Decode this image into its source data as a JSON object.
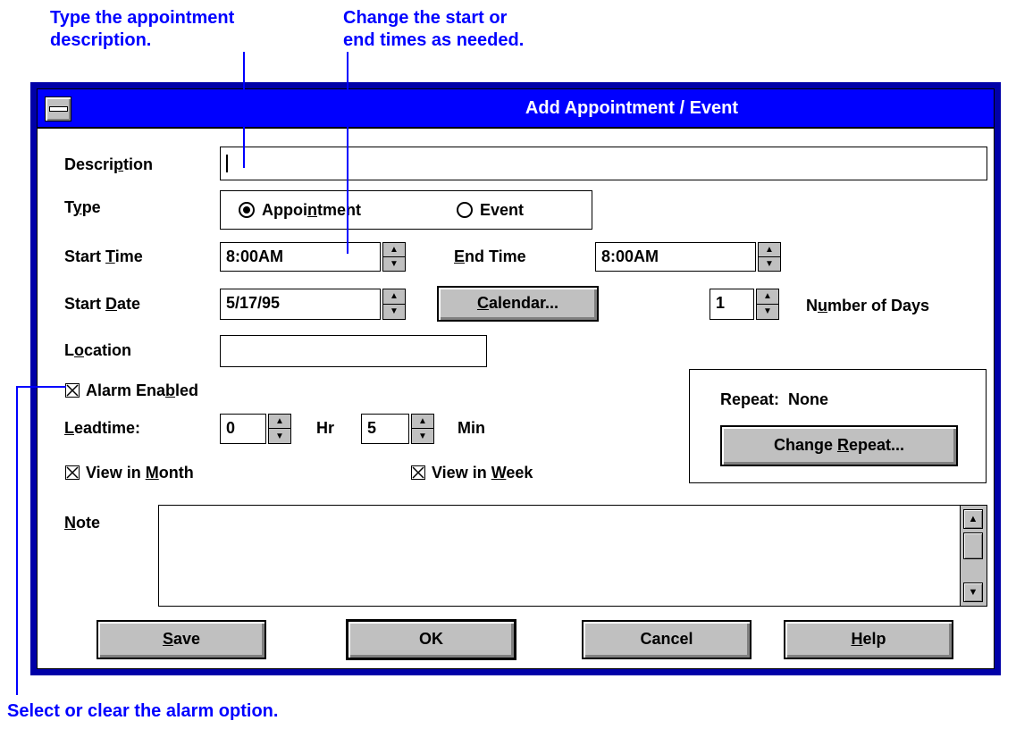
{
  "callouts": {
    "description": [
      "Type the appointment",
      "description."
    ],
    "times": [
      "Change the start or",
      "end times as needed."
    ],
    "alarm": "Select or clear the alarm option."
  },
  "dialog": {
    "title": "Add Appointment / Event",
    "description_label": {
      "pre": "Descri",
      "key": "p",
      "post": "tion"
    },
    "description_value": "",
    "type_label": {
      "pre": "T",
      "key": "y",
      "post": "pe"
    },
    "type_options": [
      {
        "pre": "Appoi",
        "key": "n",
        "post": "tment",
        "selected": true
      },
      {
        "pre": "",
        "key": "",
        "post": "Event",
        "selected": false
      }
    ],
    "start_time_label": {
      "pre": "Start ",
      "key": "T",
      "post": "ime"
    },
    "start_time": "8:00AM",
    "end_time_label": {
      "pre": "",
      "key": "E",
      "post": "nd Time"
    },
    "end_time": "8:00AM",
    "start_date_label": {
      "pre": "Start ",
      "key": "D",
      "post": "ate"
    },
    "start_date": "5/17/95",
    "calendar_button": {
      "pre": "",
      "key": "C",
      "post": "alendar..."
    },
    "num_days": "1",
    "num_days_label": {
      "pre": "N",
      "key": "u",
      "post": "mber of Days"
    },
    "location_label": {
      "pre": "L",
      "key": "o",
      "post": "cation"
    },
    "location_value": "",
    "alarm_enabled": {
      "label_pre": "Alarm Ena",
      "key": "b",
      "label_post": "led",
      "checked": true
    },
    "leadtime_label": {
      "pre": "",
      "key": "L",
      "post": "eadtime:"
    },
    "leadtime_hr": "0",
    "hr_label": "Hr",
    "leadtime_min": "5",
    "min_label": "Min",
    "view_month": {
      "pre": "View in ",
      "key": "M",
      "post": "onth",
      "checked": true
    },
    "view_week": {
      "pre": "View in ",
      "key": "W",
      "post": "eek",
      "checked": true
    },
    "repeat_label": "Repeat:",
    "repeat_value": "None",
    "change_repeat_button": {
      "pre": "Change ",
      "key": "R",
      "post": "epeat..."
    },
    "note_label": {
      "pre": "",
      "key": "N",
      "post": "ote"
    },
    "note_value": "",
    "buttons": {
      "save": {
        "pre": "",
        "key": "S",
        "post": "ave"
      },
      "ok": "OK",
      "cancel": "Cancel",
      "help": {
        "pre": "",
        "key": "H",
        "post": "elp"
      }
    }
  },
  "colors": {
    "callout": "#0000ff",
    "titlebar": "#0000ff",
    "frame": "#0000a8",
    "button_face": "#c0c0c0"
  },
  "icons": [
    "system-menu-icon",
    "spin-up-icon",
    "spin-down-icon",
    "radio-icon",
    "checkbox-icon",
    "scroll-up-icon",
    "scroll-down-icon"
  ]
}
